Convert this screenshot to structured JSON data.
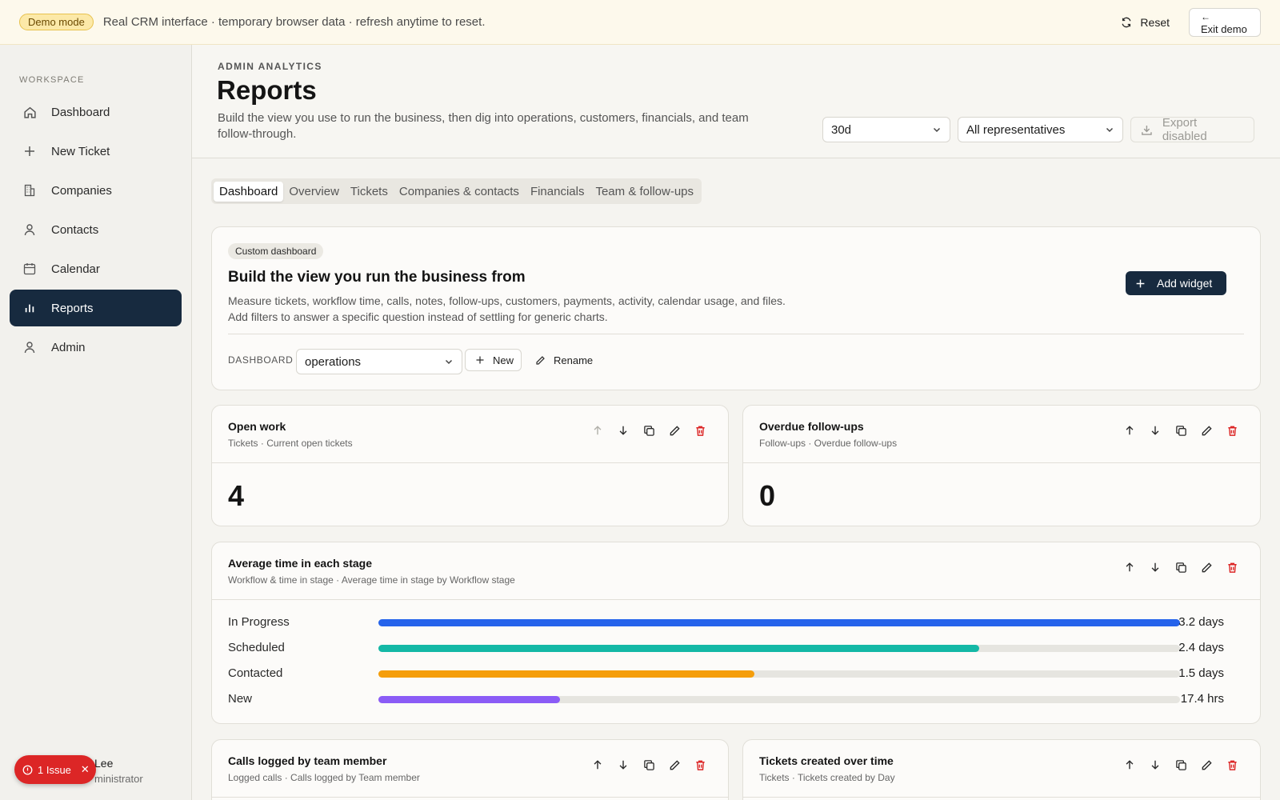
{
  "banner": {
    "badge": "Demo mode",
    "text": "Real CRM interface · temporary browser data · refresh anytime to reset.",
    "reset_label": "Reset",
    "exit_label": "Exit demo"
  },
  "sidebar": {
    "heading": "WORKSPACE",
    "items": [
      {
        "label": "Dashboard",
        "icon": "home-icon"
      },
      {
        "label": "New Ticket",
        "icon": "plus-icon"
      },
      {
        "label": "Companies",
        "icon": "building-icon"
      },
      {
        "label": "Contacts",
        "icon": "person-icon"
      },
      {
        "label": "Calendar",
        "icon": "calendar-icon"
      },
      {
        "label": "Reports",
        "icon": "bar-chart-icon",
        "active": true
      },
      {
        "label": "Admin",
        "icon": "person-icon"
      }
    ],
    "user": {
      "name": "Lee",
      "role": "ministrator"
    },
    "issue": {
      "label": "1 Issue"
    }
  },
  "header": {
    "eyebrow": "ADMIN ANALYTICS",
    "title": "Reports",
    "description": "Build the view you use to run the business, then dig into operations, customers, financials, and team follow-through.",
    "range_value": "30d",
    "rep_value": "All representatives",
    "export_label": "Export disabled"
  },
  "tabs": [
    {
      "label": "Dashboard",
      "active": true
    },
    {
      "label": "Overview"
    },
    {
      "label": "Tickets"
    },
    {
      "label": "Companies & contacts"
    },
    {
      "label": "Financials"
    },
    {
      "label": "Team & follow-ups"
    }
  ],
  "custom": {
    "badge": "Custom dashboard",
    "title": "Build the view you run the business from",
    "description_1": "Measure tickets, workflow time, calls, notes, follow-ups, customers, payments, activity, calendar usage, and files.",
    "description_2": "Add filters to answer a specific question instead of settling for generic charts.",
    "add_widget_label": "Add widget",
    "dashboard_label": "DASHBOARD",
    "dashboard_value": "operations",
    "new_label": "New",
    "rename_label": "Rename"
  },
  "widgets": {
    "open_work": {
      "title": "Open work",
      "subtitle": "Tickets · Current open tickets",
      "value": "4"
    },
    "overdue": {
      "title": "Overdue follow-ups",
      "subtitle": "Follow-ups · Overdue follow-ups",
      "value": "0"
    },
    "stage_time": {
      "title": "Average time in each stage",
      "subtitle": "Workflow & time in stage · Average time in stage by Workflow stage"
    },
    "calls": {
      "title": "Calls logged by team member",
      "subtitle": "Logged calls · Calls logged by Team member"
    },
    "tickets_created": {
      "title": "Tickets created over time",
      "subtitle": "Tickets · Tickets created by Day"
    }
  },
  "chart_data": {
    "type": "bar",
    "orientation": "horizontal",
    "categories": [
      "In Progress",
      "Scheduled",
      "Contacted",
      "New"
    ],
    "values": [
      3.2,
      2.4,
      1.5,
      0.725
    ],
    "value_labels": [
      "3.2 days",
      "2.4 days",
      "1.5 days",
      "17.4 hrs"
    ],
    "unit": "days",
    "xlim": [
      0,
      3.2
    ],
    "colors": [
      "#2563eb",
      "#14b8a6",
      "#f59e0b",
      "#8b5cf6"
    ]
  }
}
